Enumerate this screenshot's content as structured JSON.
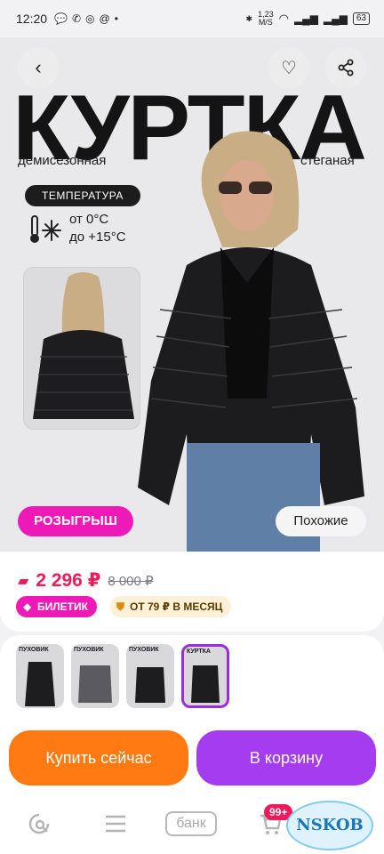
{
  "status_bar": {
    "time": "12:20",
    "net_speed": "1,23",
    "net_unit": "M/S",
    "battery": "63"
  },
  "hero": {
    "title": "КУРТКА",
    "subtitle_left": "демисезонная",
    "subtitle_right": "стеганая",
    "temp_badge": "ТЕМПЕРАТУРА",
    "temp_from": "от 0°C",
    "temp_to": "до +15°C",
    "raffle_button": "РОЗЫГРЫШ",
    "similar_button": "Похожие"
  },
  "price": {
    "current": "2 296 ₽",
    "old": "8 000 ₽",
    "ticket_badge": "БИЛЕТИК",
    "installment_badge": "ОТ 79 ₽ В МЕСЯЦ"
  },
  "thumbnails": [
    {
      "label": "ПУХОВИК",
      "selected": false
    },
    {
      "label": "ПУХОВИК",
      "selected": false
    },
    {
      "label": "ПУХОВИК",
      "selected": false
    },
    {
      "label": "КУРТКА",
      "selected": true
    }
  ],
  "actions": {
    "buy_now": "Купить сейчас",
    "add_to_cart": "В корзину"
  },
  "tabbar": {
    "bank_label": "банк",
    "cart_badge": "99+"
  },
  "watermark": "NSKOB",
  "colors": {
    "accent_pink": "#ee1ab8",
    "price_red": "#f01a5b",
    "buy_orange": "#ff7a12",
    "cart_purple": "#a63cf0"
  }
}
